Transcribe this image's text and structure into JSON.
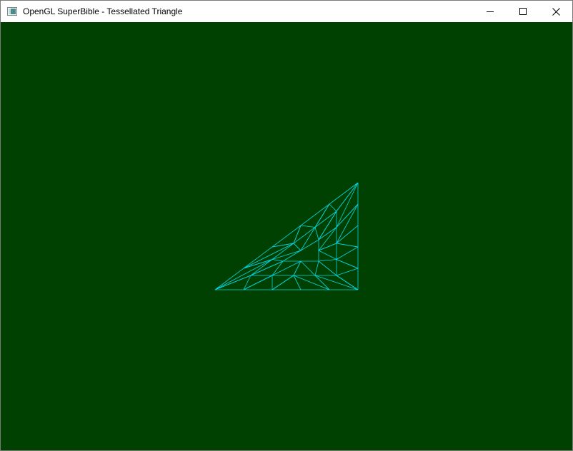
{
  "window": {
    "title": "OpenGL SuperBible - Tessellated Triangle",
    "app_icon": "app-window-icon",
    "controls": {
      "minimize_icon": "minimize-icon",
      "maximize_icon": "maximize-icon",
      "close_icon": "close-icon"
    }
  },
  "viewport": {
    "clear_color": "#004000",
    "wireframe_color": "#00d8e8",
    "render_mode": "wireframe"
  }
}
